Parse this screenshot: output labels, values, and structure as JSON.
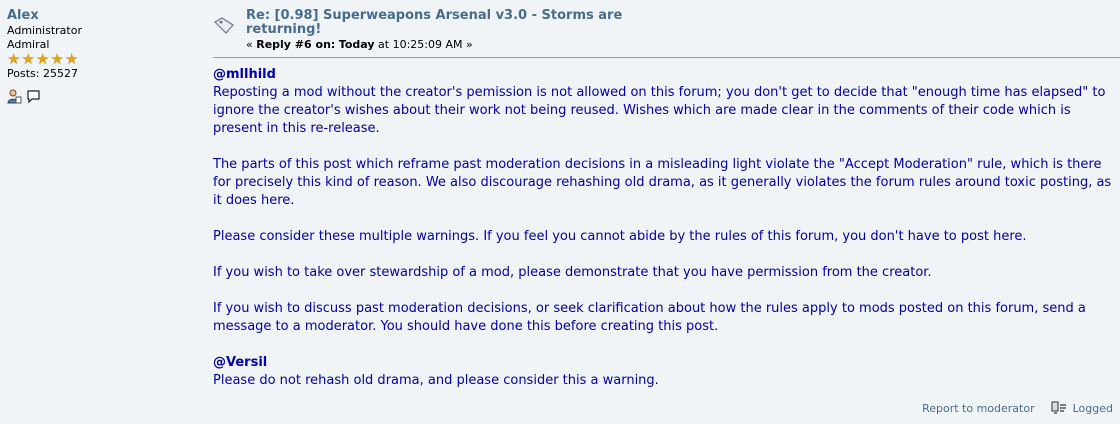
{
  "poster": {
    "name": "Alex",
    "group": "Administrator",
    "rank": "Admiral",
    "star_count": 5,
    "posts": "Posts: 25527"
  },
  "post": {
    "subject": "Re: [0.98] Superweapons Arsenal v3.0 - Storms are returning!",
    "reply_prefix": "« ",
    "reply_label": "Reply #6 on:",
    "reply_day": "Today",
    "reply_time": "at 10:25:09 AM »",
    "mention1": "@mllhild",
    "para1": "Reposting a mod without the creator's pemission is not allowed on this forum; you don't get to decide that \"enough time has elapsed\" to ignore the creator's wishes about their work not being reused. Wishes which are made clear in the comments of their code which is present in this re-release.",
    "para2": "The parts of this post which reframe past moderation decisions in a misleading light violate the \"Accept Moderation\" rule, which is there for precisely this kind of reason. We also discourage rehashing old drama, as it generally violates the forum rules around toxic posting, as it does here.",
    "para3": "Please consider these multiple warnings. If you feel you cannot abide by the rules of this forum, you don't have to post here.",
    "para4": "If you wish to take over stewardship of a mod, please demonstrate that you have permission from the creator.",
    "para5": "If you wish to discuss past moderation decisions, or seek clarification about how the rules apply to mods posted on this forum, send a message to a moderator. You should have done this before creating this post.",
    "mention2": "@Versil",
    "para6": "Please do not rehash old drama, and please consider this a warning."
  },
  "footer": {
    "report": "Report to moderator",
    "logged": "Logged"
  },
  "colors": {
    "background": "#f0f4f7",
    "link": "#476c8e",
    "body_text": "#0000aa",
    "star": "#e7a21a"
  },
  "icons": [
    "xx-icon",
    "star-icon",
    "profile-icon",
    "message-icon",
    "logged-ip-icon"
  ]
}
